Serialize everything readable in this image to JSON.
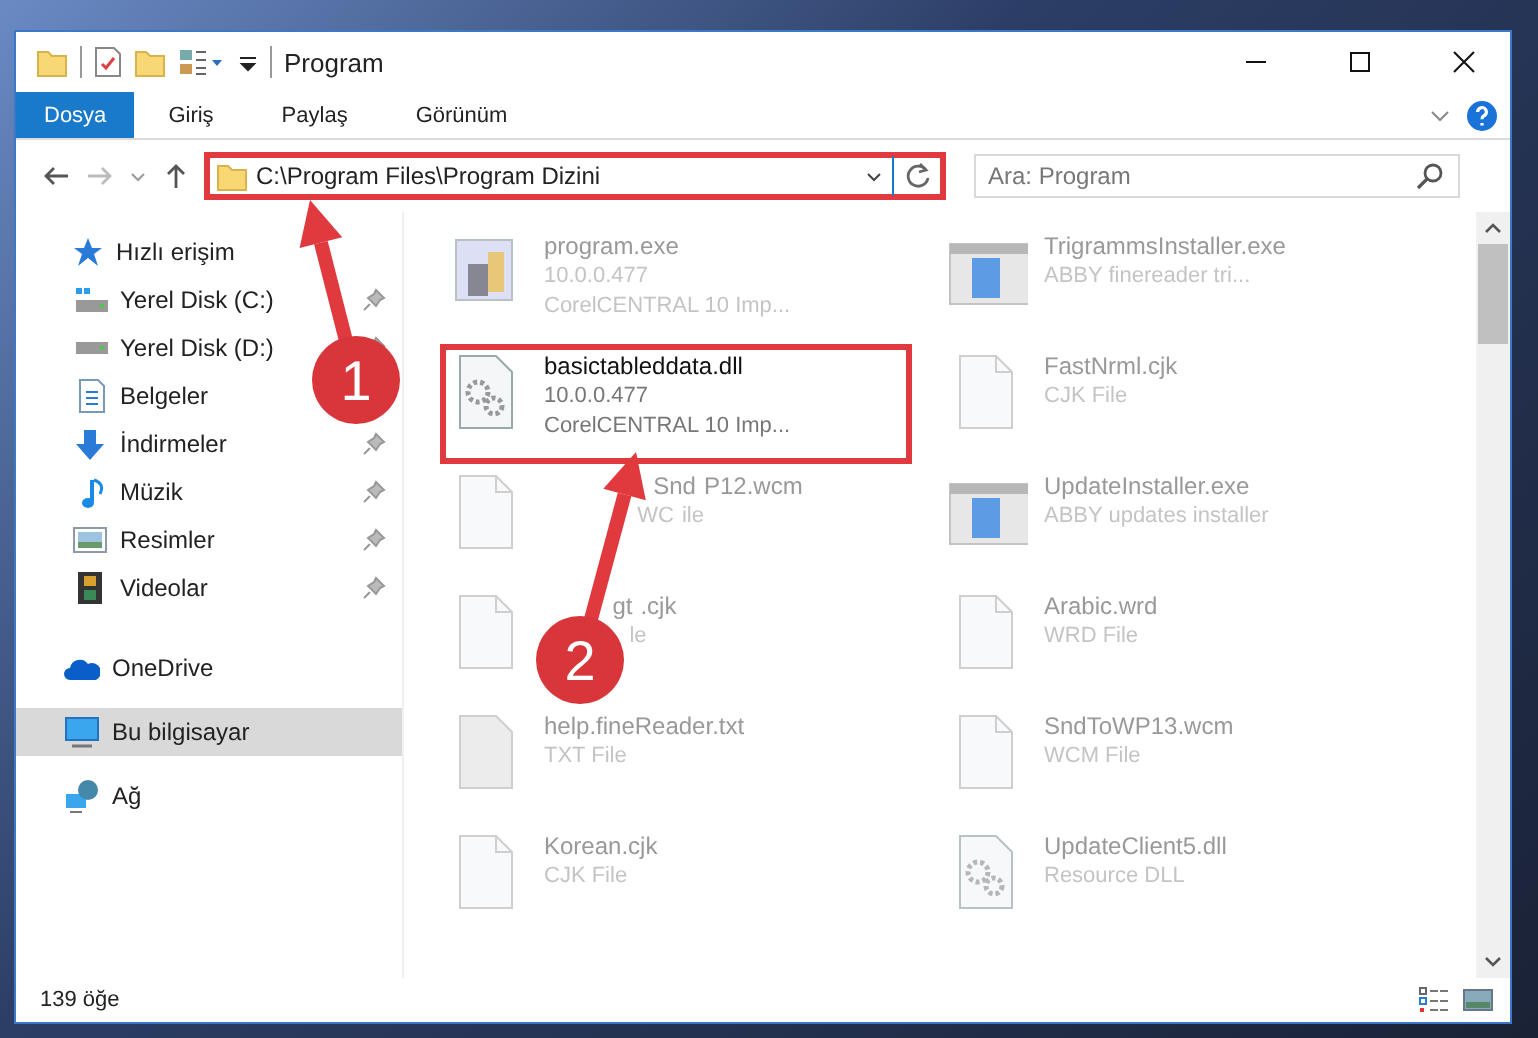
{
  "window": {
    "title": "Program"
  },
  "ribbon_tabs": [
    {
      "label": "Dosya",
      "selected": true
    },
    {
      "label": "Giriş",
      "selected": false
    },
    {
      "label": "Paylaş",
      "selected": false
    },
    {
      "label": "Görünüm",
      "selected": false
    }
  ],
  "address_bar": {
    "path": "C:\\Program Files\\Program Dizini",
    "highlighted": true
  },
  "search": {
    "placeholder": "Ara: Program"
  },
  "sidebar": {
    "items": [
      {
        "label": "Hızlı erişim",
        "kind": "star",
        "pinned": false,
        "selected": false,
        "children": [
          {
            "label": "Yerel Disk (C:)",
            "kind": "disk-c",
            "pinned": true,
            "selected": false
          },
          {
            "label": "Yerel Disk (D:)",
            "kind": "disk",
            "pinned": true,
            "selected": false
          },
          {
            "label": "Belgeler",
            "kind": "docs",
            "pinned": false,
            "selected": false
          },
          {
            "label": "İndirmeler",
            "kind": "download",
            "pinned": true,
            "selected": false
          },
          {
            "label": "Müzik",
            "kind": "music",
            "pinned": true,
            "selected": false
          },
          {
            "label": "Resimler",
            "kind": "pictures",
            "pinned": true,
            "selected": false
          },
          {
            "label": "Videolar",
            "kind": "video",
            "pinned": true,
            "selected": false
          }
        ]
      },
      {
        "label": "OneDrive",
        "kind": "cloud",
        "pinned": false,
        "selected": false
      },
      {
        "label": "Bu bilgisayar",
        "kind": "computer",
        "pinned": false,
        "selected": true
      },
      {
        "label": "Ağ",
        "kind": "network",
        "pinned": false,
        "selected": false
      }
    ]
  },
  "files": [
    {
      "name": [
        "program.exe"
      ],
      "lines": [
        [
          "10.0.0.477"
        ],
        [
          "CorelCENTRAL 10 Imp..."
        ]
      ],
      "kind": "exe",
      "blurred": true,
      "highlighted": false
    },
    {
      "name": [
        "TrigrammsInstaller.exe"
      ],
      "lines": [
        [
          "ABBY finereader tri..."
        ]
      ],
      "kind": "installer",
      "blurred": true,
      "highlighted": false
    },
    {
      "name": [
        "basictableddata.dll"
      ],
      "lines": [
        [
          "10.0.0.477"
        ],
        [
          "CorelCENTRAL 10 Imp..."
        ]
      ],
      "kind": "dll",
      "blurred": false,
      "highlighted": true
    },
    {
      "name": [
        "FastNrml.cjk"
      ],
      "lines": [
        [
          "CJK File"
        ]
      ],
      "kind": "file",
      "blurred": true,
      "highlighted": false
    },
    {
      "name": [
        "Snd",
        "P12.wcm"
      ],
      "lines": [
        [
          "WC",
          "ile"
        ]
      ],
      "kind": "file",
      "blurred": true,
      "highlighted": false
    },
    {
      "name": [
        "UpdateInstaller.exe"
      ],
      "lines": [
        [
          "ABBY updates installer"
        ]
      ],
      "kind": "installer",
      "blurred": true,
      "highlighted": false
    },
    {
      "name": [
        "gt",
        ".cjk"
      ],
      "lines": [
        [
          "le"
        ]
      ],
      "kind": "file",
      "blurred": true,
      "highlighted": false
    },
    {
      "name": [
        "Arabic.wrd"
      ],
      "lines": [
        [
          "WRD File"
        ]
      ],
      "kind": "file",
      "blurred": true,
      "highlighted": false
    },
    {
      "name": [
        "help.fineReader.txt"
      ],
      "lines": [
        [
          "TXT File"
        ]
      ],
      "kind": "txt",
      "blurred": true,
      "highlighted": false
    },
    {
      "name": [
        "SndToWP13.wcm"
      ],
      "lines": [
        [
          "WCM File"
        ]
      ],
      "kind": "file",
      "blurred": true,
      "highlighted": false
    },
    {
      "name": [
        "Korean.cjk"
      ],
      "lines": [
        [
          "CJK File"
        ]
      ],
      "kind": "file",
      "blurred": true,
      "highlighted": false
    },
    {
      "name": [
        "UpdateClient5.dll"
      ],
      "lines": [
        [
          "Resource DLL"
        ]
      ],
      "kind": "dll",
      "blurred": true,
      "highlighted": false
    }
  ],
  "status_bar": {
    "count": "139 öğe"
  },
  "annotations": [
    {
      "number": "1"
    },
    {
      "number": "2"
    }
  ]
}
